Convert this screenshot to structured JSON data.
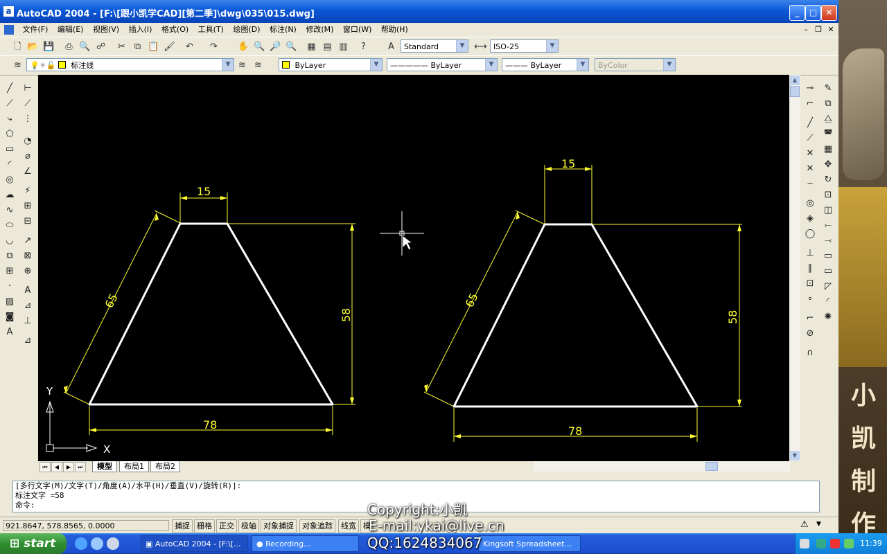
{
  "window": {
    "title": "AutoCAD 2004 - [F:\\[跟小凯学CAD][第二季]\\dwg\\035\\015.dwg]",
    "app_icon": "a",
    "minimize_icon": "minimize-icon",
    "maximize_icon": "maximize-icon",
    "close_icon": "close-icon"
  },
  "menu": [
    "文件(F)",
    "编辑(E)",
    "视图(V)",
    "插入(I)",
    "格式(O)",
    "工具(T)",
    "绘图(D)",
    "标注(N)",
    "修改(M)",
    "窗口(W)",
    "帮助(H)"
  ],
  "styles": {
    "text_style": "Standard",
    "dim_style": "ISO-25"
  },
  "layers": {
    "current_layer": "标注线",
    "color": "ByLayer",
    "linetype": "ByLayer",
    "lineweight": "ByLayer",
    "plot_style": "ByColor"
  },
  "drawing": {
    "left_shape": {
      "top_width": "15",
      "slant": "65",
      "height": "58",
      "base": "78"
    },
    "right_shape": {
      "top_width": "15",
      "slant": "65",
      "height": "58",
      "base": "78"
    },
    "ucs_x": "X",
    "ucs_y": "Y",
    "colors": {
      "background": "#000000",
      "object": "#ffffff",
      "dimension": "#ffff33"
    }
  },
  "layout_tabs": [
    "模型",
    "布局1",
    "布局2"
  ],
  "command": {
    "line1": "[多行文字(M)/文字(T)/角度(A)/水平(H)/垂直(V)/旋转(R)]:",
    "line2": "标注文字 =58",
    "line3": "命令:"
  },
  "status": {
    "coords": "921.8647, 578.8565, 0.0000",
    "toggles": [
      "捕捉",
      "栅格",
      "正交",
      "极轴",
      "对象捕捉",
      "对象追踪",
      "线宽",
      "模"
    ]
  },
  "overlay": {
    "copyright": "Copyright:小凯",
    "email": "E-mail:ykai@live.cn",
    "qq": "QQ:1624834067"
  },
  "watermark": [
    "小",
    "凯",
    "制",
    "作"
  ],
  "taskbar": {
    "start": "start",
    "tasks": [
      "AutoCAD 2004 - [F:\\[...",
      "Recording...",
      "Kingsoft Spreadsheet..."
    ],
    "clock": "11:39"
  }
}
